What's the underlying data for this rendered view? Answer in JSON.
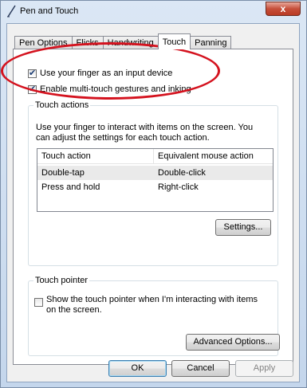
{
  "window": {
    "title": "Pen and Touch",
    "close_glyph": "x"
  },
  "tabs": [
    {
      "label": "Pen Options"
    },
    {
      "label": "Flicks"
    },
    {
      "label": "Handwriting"
    },
    {
      "label": "Touch",
      "active": true
    },
    {
      "label": "Panning"
    }
  ],
  "touch": {
    "use_finger": {
      "label": "Use your finger as an input device",
      "checked": true
    },
    "multitouch": {
      "label": "Enable multi-touch gestures and inking",
      "checked": true
    },
    "actions_group": {
      "title": "Touch actions",
      "description_1": "Use your finger to interact with items on the screen. You",
      "description_2": "can adjust the settings for each touch action.",
      "columns": [
        "Touch action",
        "Equivalent mouse action"
      ],
      "rows": [
        {
          "action": "Double-tap",
          "mouse": "Double-click"
        },
        {
          "action": "Press and hold",
          "mouse": "Right-click"
        }
      ],
      "settings_button": "Settings..."
    },
    "pointer_group": {
      "title": "Touch pointer",
      "show_pointer_line1": "Show the touch pointer when I'm interacting with items",
      "show_pointer_line2": "on the screen.",
      "show_pointer_checked": false,
      "advanced_button": "Advanced Options..."
    }
  },
  "buttons": {
    "ok": "OK",
    "cancel": "Cancel",
    "apply": "Apply"
  },
  "annotation_color": "#d4121e"
}
